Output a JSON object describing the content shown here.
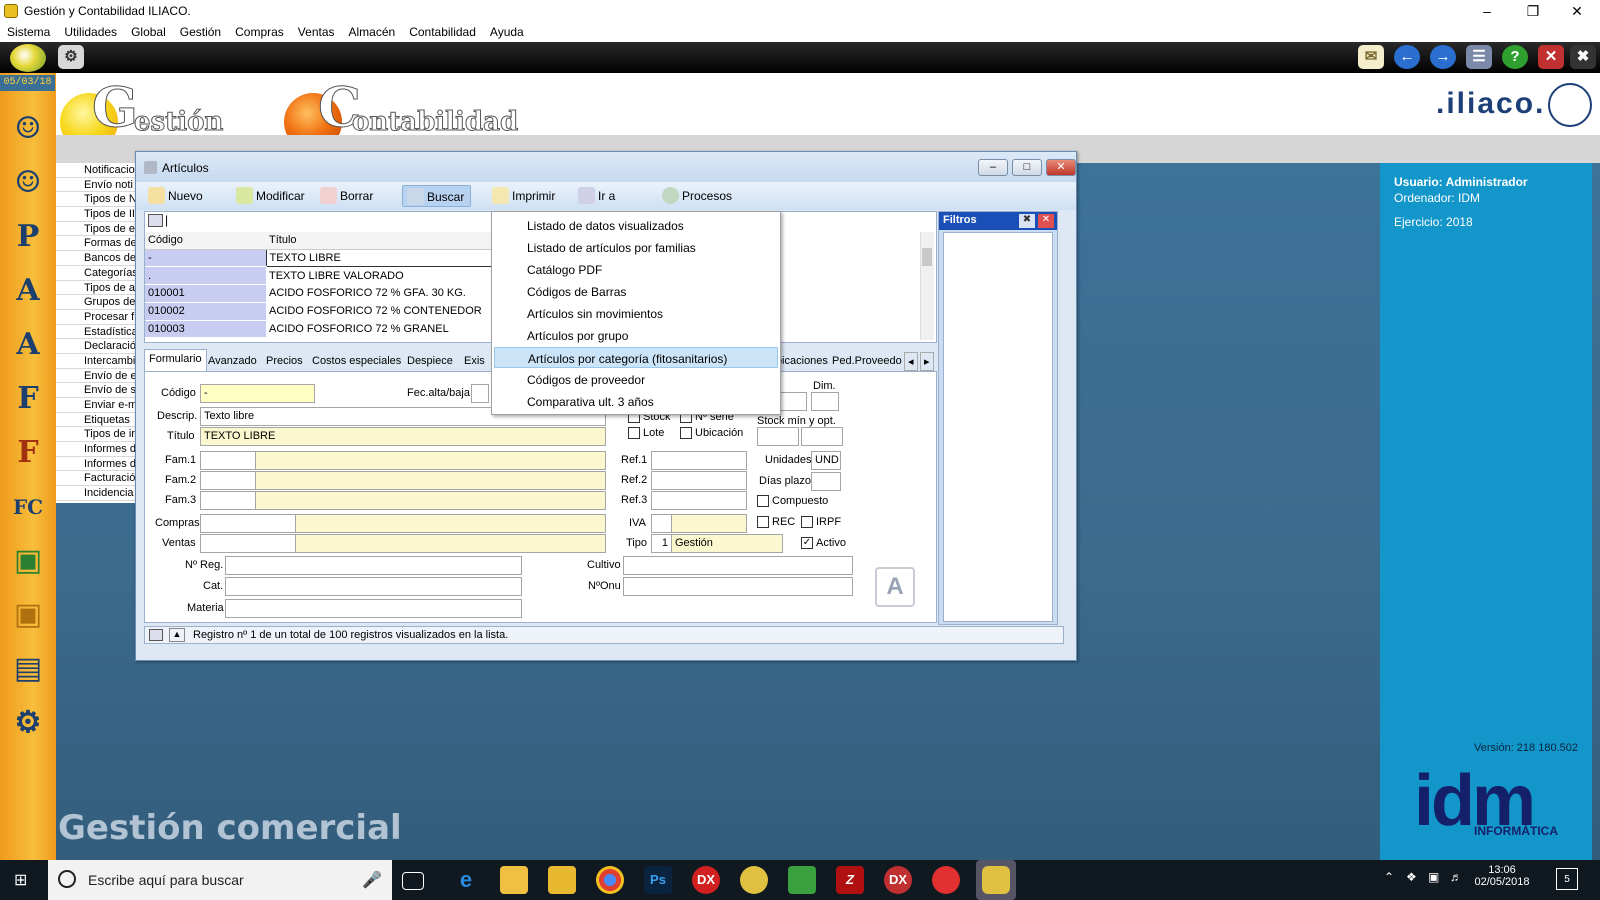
{
  "window_title": "Gestión y Contabilidad ILIACO.",
  "menu": [
    "Sistema",
    "Utilidades",
    "Global",
    "Gestión",
    "Compras",
    "Ventas",
    "Almacén",
    "Contabilidad",
    "Ayuda"
  ],
  "date": "05/03/18",
  "logos": {
    "gestion": "estión",
    "gestion_letter": "G",
    "contabilidad": "ontabilidad",
    "contabilidad_letter": "C",
    "brand": ".iliaco."
  },
  "notif_list": [
    "Notificacio",
    "Envío noti",
    "Tipos de N",
    "Tipos de II",
    "Tipos de e",
    "Formas de",
    "Bancos de",
    "Categorías",
    "Tipos de a",
    "Grupos de",
    "Procesar f",
    "Estadística",
    "Declaració",
    "Intercambi",
    "Envío de e",
    "Envío de s",
    "Enviar e-m",
    "Etiquetas",
    "Tipos de ir",
    "Informes d",
    "Informes d",
    "Facturació",
    "Incidencia"
  ],
  "right_panel": {
    "usuario": "Usuario: Administrador",
    "ordenador": "Ordenador: IDM",
    "ejercicio": "Ejercicio: 2018",
    "version": "Versión: 218 180.502",
    "idm": "idm",
    "informatica": "INFORMÁTICA"
  },
  "watermark": "Gestión comercial",
  "articulos": {
    "title": "Artículos",
    "toolbar": [
      "Nuevo",
      "Modificar",
      "Borrar",
      "Buscar",
      "Imprimir",
      "Ir a",
      "Procesos"
    ],
    "grid_headers": [
      "Código",
      "Título"
    ],
    "rows": [
      {
        "code": "-",
        "title": "TEXTO LIBRE"
      },
      {
        "code": ".",
        "title": "TEXTO LIBRE VALORADO"
      },
      {
        "code": "010001",
        "title": "ACIDO FOSFORICO 72 % GFA. 30 KG."
      },
      {
        "code": "010002",
        "title": "ACIDO FOSFORICO 72 % CONTENEDOR"
      },
      {
        "code": "010003",
        "title": "ACIDO FOSFORICO 72 % GRANEL"
      }
    ],
    "tabs": [
      "Formulario",
      "Avanzado",
      "Precios",
      "Costos especiales",
      "Despiece",
      "Exis",
      "Ubicaciones",
      "Ped.Proveedo"
    ],
    "form": {
      "codigo_label": "Código",
      "codigo_value": "-",
      "fecalta_label": "Fec.alta/baja",
      "descrip_label": "Descrip.",
      "descrip_value": "Texto libre",
      "titulo_label": "Título",
      "titulo_value": "TEXTO LIBRE",
      "fam1": "Fam.1",
      "fam2": "Fam.2",
      "fam3": "Fam.3",
      "compras": "Compras",
      "ventas": "Ventas",
      "nreg": "Nº Reg.",
      "cat": "Cat.",
      "materia": "Materia",
      "ref1": "Ref.1",
      "ref2": "Ref.2",
      "ref3": "Ref.3",
      "iva": "IVA",
      "tipo": "Tipo",
      "tipo_num": "1",
      "tipo_value": "Gestión",
      "cultivo": "Cultivo",
      "nonu": "NºOnu",
      "stock": "Stock",
      "nserie": "Nº serie",
      "lote": "Lote",
      "ubicacion": "Ubicación",
      "ck": "ck",
      "dim": "Dim.",
      "stockminopt": "Stock mín y opt.",
      "unidades": "Unidades",
      "unidades_value": "UND",
      "diasplazo": "Días plazo",
      "compuesto": "Compuesto",
      "rec": "REC",
      "irpf": "IRPF",
      "activo": "Activo"
    },
    "status": "Registro nº 1 de un total de 100 registros visualizados en la lista.",
    "filtros": "Filtros"
  },
  "dropdown": [
    "Listado de datos visualizados",
    "Listado de artículos por familias",
    "Catálogo PDF",
    "Códigos de Barras",
    "Artículos sin movimientos",
    "Artículos por grupo",
    "Artículos por categoría (fitosanitarios)",
    "Códigos de proveedor",
    "Comparativa ult. 3 años"
  ],
  "dropdown_selected": 6,
  "taskbar": {
    "search_placeholder": "Escribe aquí para buscar",
    "time": "13:06",
    "date": "02/05/2018",
    "notif_count": "5"
  }
}
